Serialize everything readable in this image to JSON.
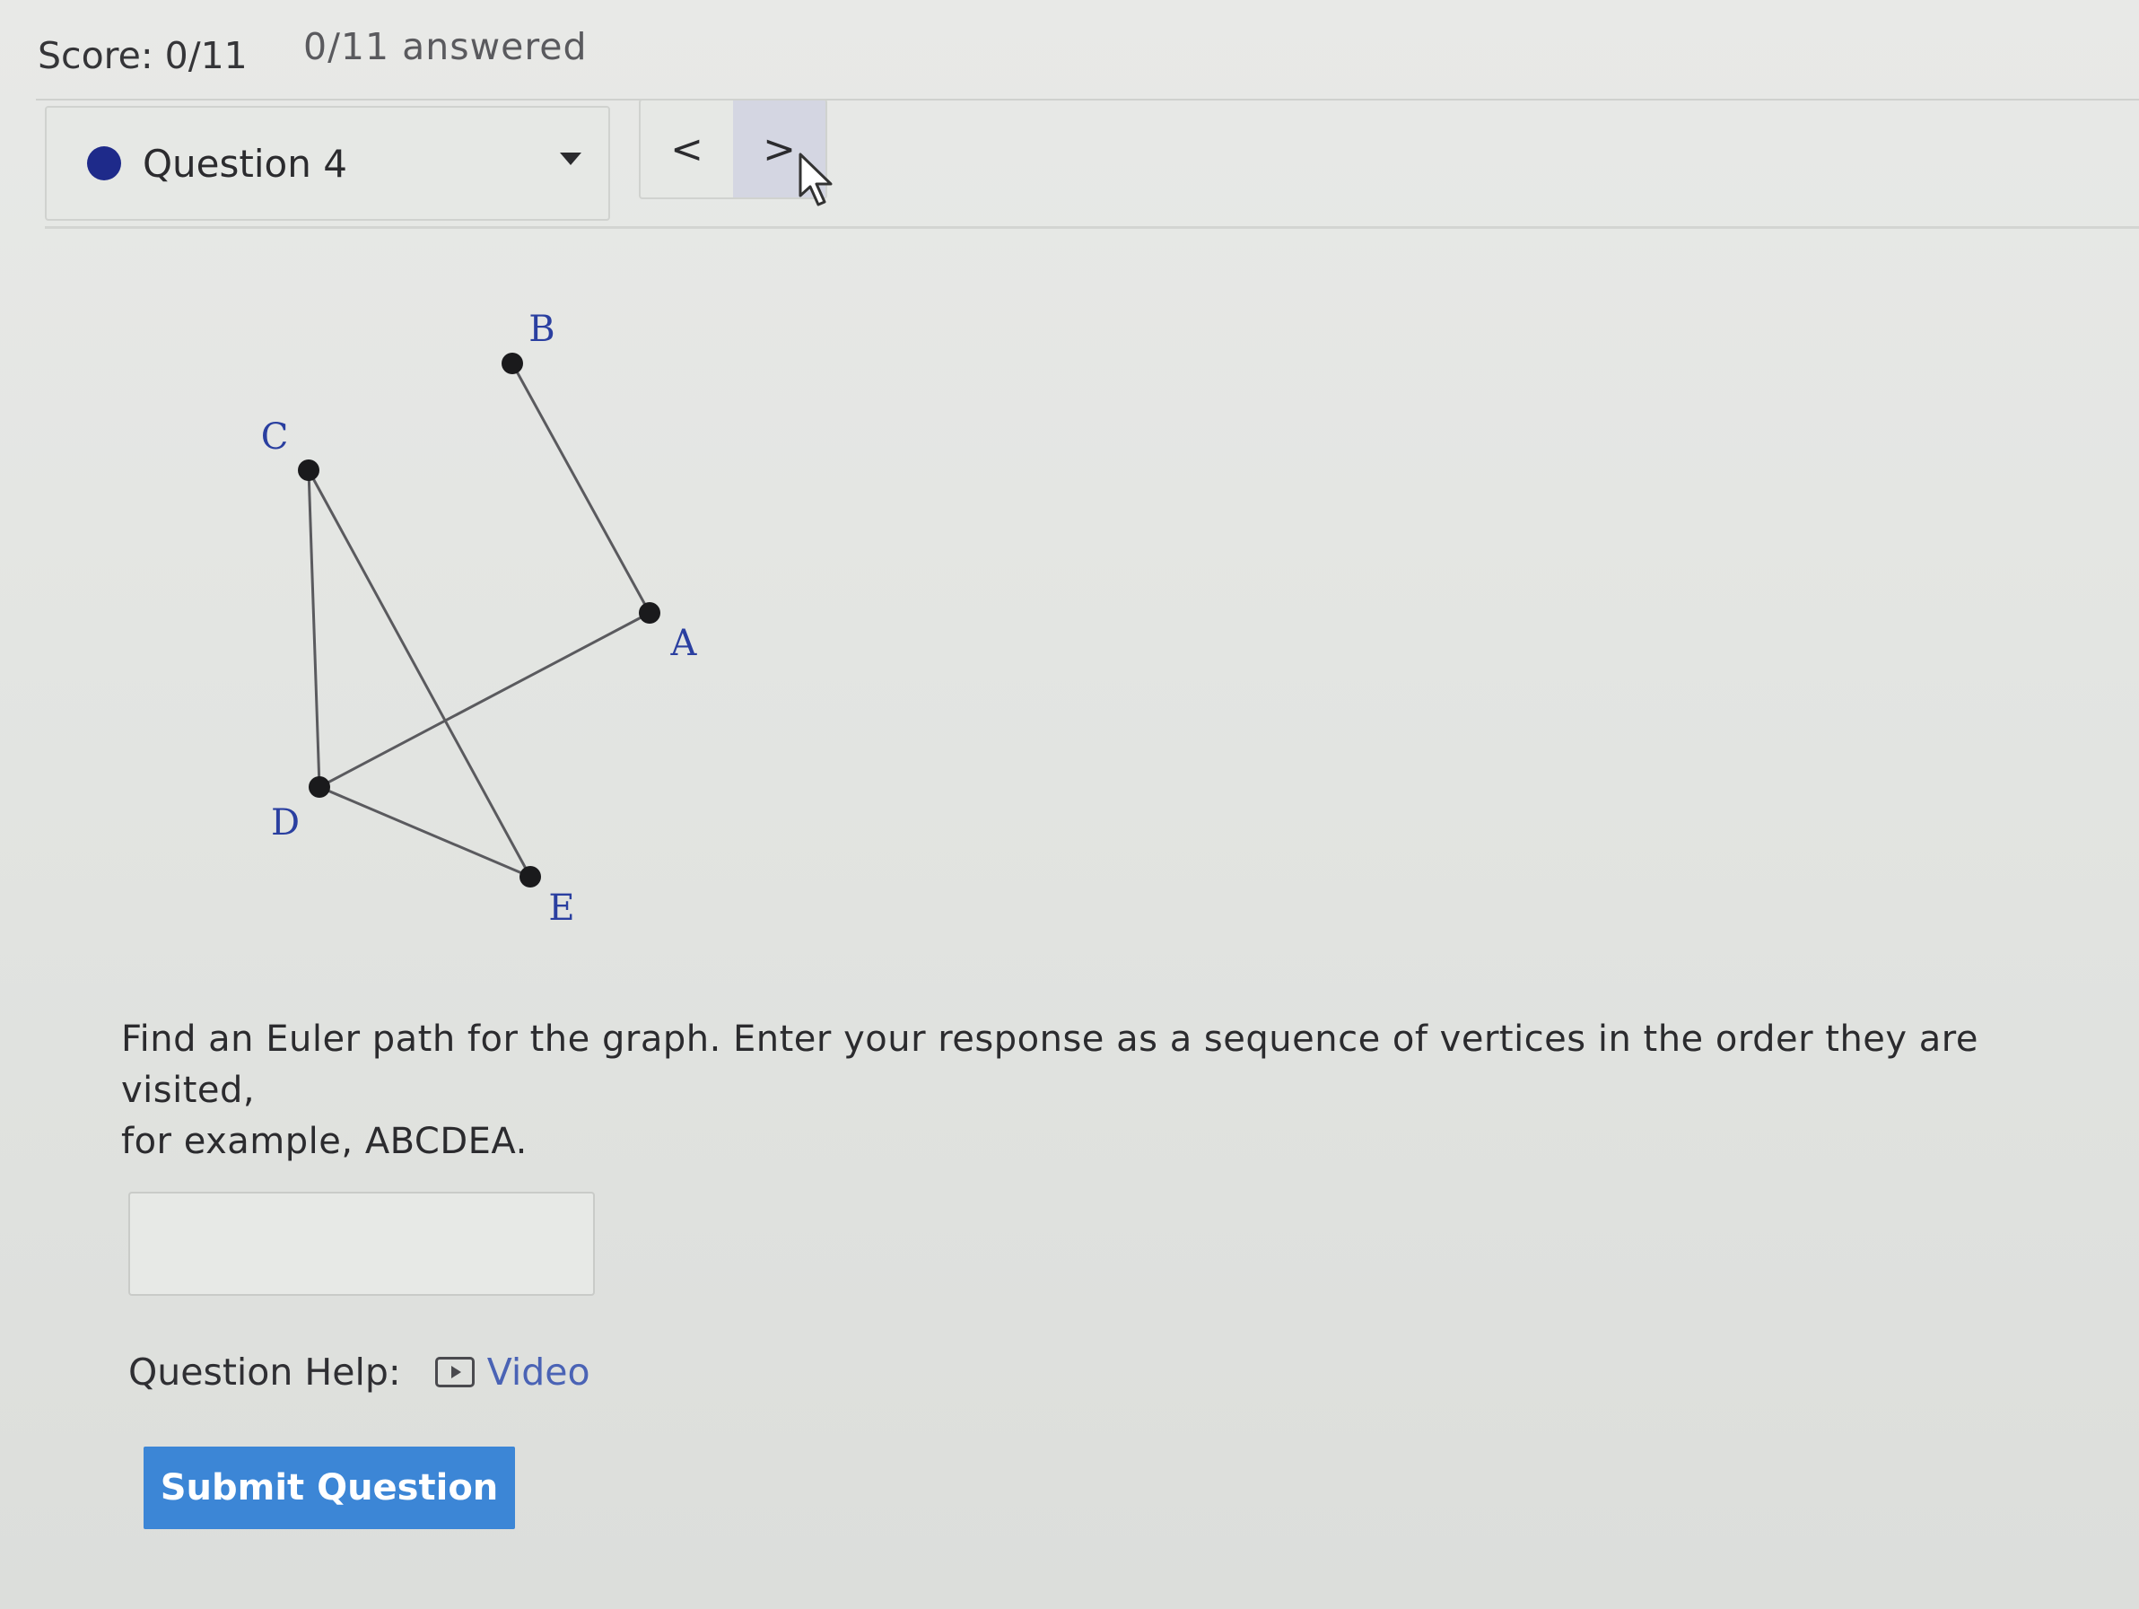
{
  "header": {
    "score": "Score: 0/11",
    "answered": "0/11 answered"
  },
  "question_selector": {
    "label": "Question 4",
    "status_color": "#1e2a8a"
  },
  "nav": {
    "prev_label": "<",
    "next_label": ">"
  },
  "graph": {
    "vertices": [
      {
        "id": "A",
        "label": "A"
      },
      {
        "id": "B",
        "label": "B"
      },
      {
        "id": "C",
        "label": "C"
      },
      {
        "id": "D",
        "label": "D"
      },
      {
        "id": "E",
        "label": "E"
      }
    ],
    "edges": [
      [
        "B",
        "A"
      ],
      [
        "A",
        "D"
      ],
      [
        "C",
        "D"
      ],
      [
        "C",
        "E"
      ],
      [
        "D",
        "E"
      ]
    ]
  },
  "prompt": {
    "line1": "Find an Euler path for the graph. Enter your response as a sequence of vertices in the order they are visited,",
    "line2": "for example, ABCDEA."
  },
  "answer": {
    "value": "",
    "placeholder": ""
  },
  "help": {
    "label": "Question Help:",
    "video_label": "Video"
  },
  "submit": {
    "label": "Submit Question",
    "color": "#3c86d6"
  }
}
